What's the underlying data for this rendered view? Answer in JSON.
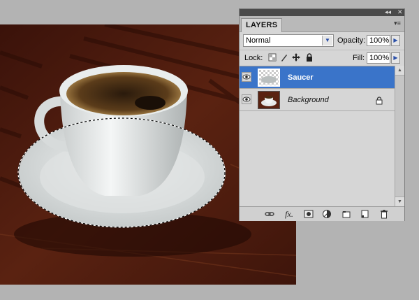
{
  "panel": {
    "tab_label": "LAYERS",
    "collapse_glyph": "◂◂",
    "close_glyph": "✕",
    "menu_glyph": "▾≡",
    "blend_mode": "Normal",
    "opacity_label": "Opacity:",
    "opacity_value": "100%",
    "lock_label": "Lock:",
    "fill_label": "Fill:",
    "fill_value": "100%"
  },
  "layers": [
    {
      "name": "Saucer",
      "selected": true,
      "visible": true,
      "locked": false
    },
    {
      "name": "Background",
      "selected": false,
      "visible": true,
      "locked": true
    }
  ],
  "bottom_icons": [
    "link-layers-icon",
    "fx-icon",
    "layer-mask-icon",
    "adjustment-layer-icon",
    "new-group-icon",
    "new-layer-icon",
    "delete-layer-icon"
  ],
  "colors": {
    "selection_blue": "#3a74c9",
    "panel_bg": "#d6d6d6",
    "workspace_bg": "#b3b3b3",
    "table_wood": "#5a1f10"
  }
}
